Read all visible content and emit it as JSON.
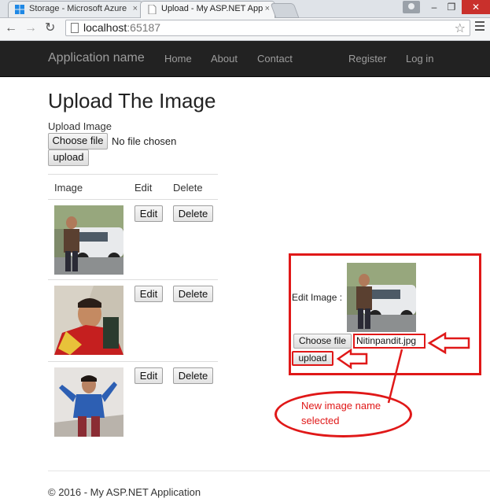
{
  "browser": {
    "tabs": [
      {
        "title": "Storage - Microsoft Azure",
        "close": "×"
      },
      {
        "title": "Upload - My ASP.NET App",
        "close": "×"
      }
    ],
    "window_controls": {
      "minimize": "–",
      "maximize": "❐",
      "close": "✕"
    },
    "nav_icons": {
      "back": "←",
      "forward": "→",
      "reload": "↻"
    },
    "url_host": "localhost",
    "url_port": ":65187",
    "bookmark_icon": "☆"
  },
  "navbar": {
    "brand": "Application name",
    "links": [
      "Home",
      "About",
      "Contact"
    ],
    "right_links": [
      "Register",
      "Log in"
    ]
  },
  "main": {
    "title": "Upload The Image",
    "upload_label": "Upload Image",
    "choose_file_label": "Choose file",
    "no_file_text": "No file chosen",
    "upload_button": "upload"
  },
  "table": {
    "headers": [
      "Image",
      "Edit",
      "Delete"
    ],
    "rows": [
      {
        "edit": "Edit",
        "delete": "Delete"
      },
      {
        "edit": "Edit",
        "delete": "Delete"
      },
      {
        "edit": "Edit",
        "delete": "Delete"
      }
    ]
  },
  "edit_panel": {
    "label": "Edit Image :",
    "choose_file_label": "Choose file",
    "file_name": "Nitinpandit.jpg",
    "upload_button": "upload"
  },
  "annotation": {
    "line1": "New image name",
    "line2": "selected",
    "color": "#e01818"
  },
  "footer": {
    "text": "© 2016 - My ASP.NET Application"
  },
  "colors": {
    "navbar_bg": "#222222",
    "navbar_text": "#9d9d9d",
    "annotation_red": "#e01818"
  }
}
